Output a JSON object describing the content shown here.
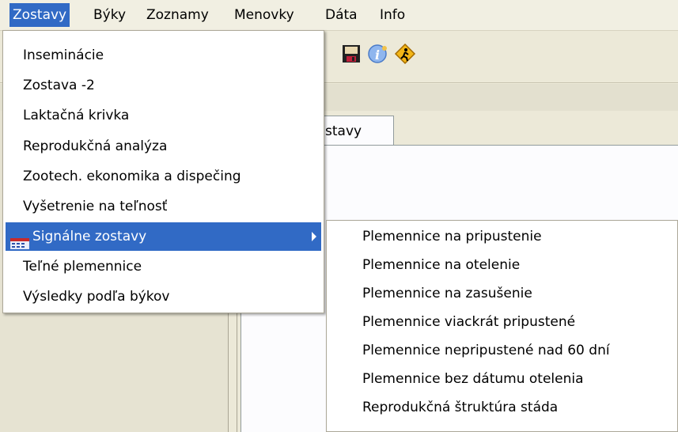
{
  "menubar": {
    "items": [
      "Zostavy",
      "Býky",
      "Zoznamy",
      "Menovky",
      "Dáta",
      "Info"
    ]
  },
  "toolbar": {
    "icons": [
      "save-icon",
      "info-icon",
      "exit-icon"
    ]
  },
  "tab": {
    "label": "stavy"
  },
  "menu": {
    "items": [
      "Inseminácie",
      "Zostava -2",
      "Laktačná krivka",
      "Reprodukčná analýza",
      "Zootech. ekonomika a dispečing",
      "Vyšetrenie na teľnosť",
      "Signálne zostavy",
      "Teľné plemennice",
      "Výsledky podľa býkov"
    ]
  },
  "submenu": {
    "items": [
      "Plemennice na pripustenie",
      "Plemennice na otelenie",
      "Plemennice na zasušenie",
      "Plemennice viackrát pripustené",
      "Plemennice nepripustené nad 60 dní",
      "Plemennice bez dátumu otelenia",
      "Reprodukčná štruktúra stáda"
    ]
  },
  "colors": {
    "highlight": "#316ac5",
    "menu_bg": "#ffffff",
    "window_bg": "#ece9d8"
  }
}
